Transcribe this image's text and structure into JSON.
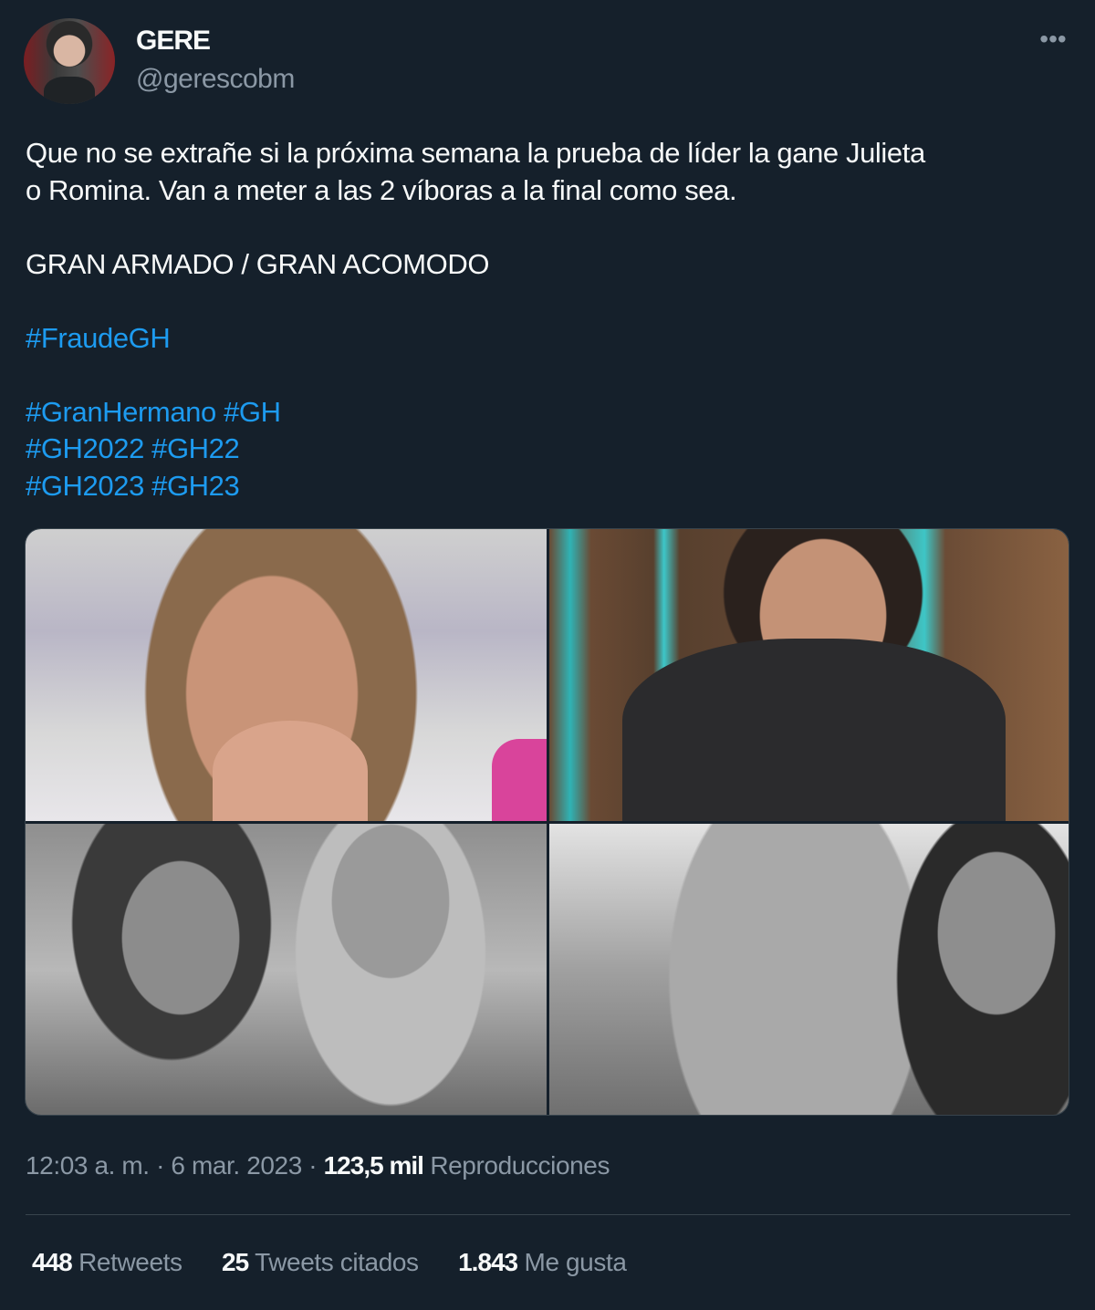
{
  "author": {
    "name": "GERE",
    "handle": "@gerescobm"
  },
  "tweet": {
    "lines": [
      "Que no se extrañe si la próxima semana la prueba de líder la gane Julieta",
      "o Romina. Van a meter a las 2 víboras a la final como sea.",
      "GRAN ARMADO / GRAN ACOMODO"
    ],
    "hashtags": {
      "fraude": "#FraudeGH",
      "granhermano": "#GranHermano",
      "gh": "#GH",
      "gh2022": "#GH2022",
      "gh22": "#GH22",
      "gh2023": "#GH2023",
      "gh23": "#GH23"
    }
  },
  "meta": {
    "time": "12:03 a. m.",
    "separator": "·",
    "date": "6 mar. 2023",
    "views_count": "123,5 mil",
    "views_label": "Reproducciones"
  },
  "stats": {
    "retweets_count": "448",
    "retweets_label": "Retweets",
    "quotes_count": "25",
    "quotes_label": "Tweets citados",
    "likes_count": "1.843",
    "likes_label": "Me gusta"
  },
  "icons": {
    "more": "more-options-icon"
  },
  "colors": {
    "background": "#15202b",
    "text": "#f7f9f9",
    "secondary": "#8b98a5",
    "link": "#1d9bf0",
    "border": "#38444d"
  }
}
